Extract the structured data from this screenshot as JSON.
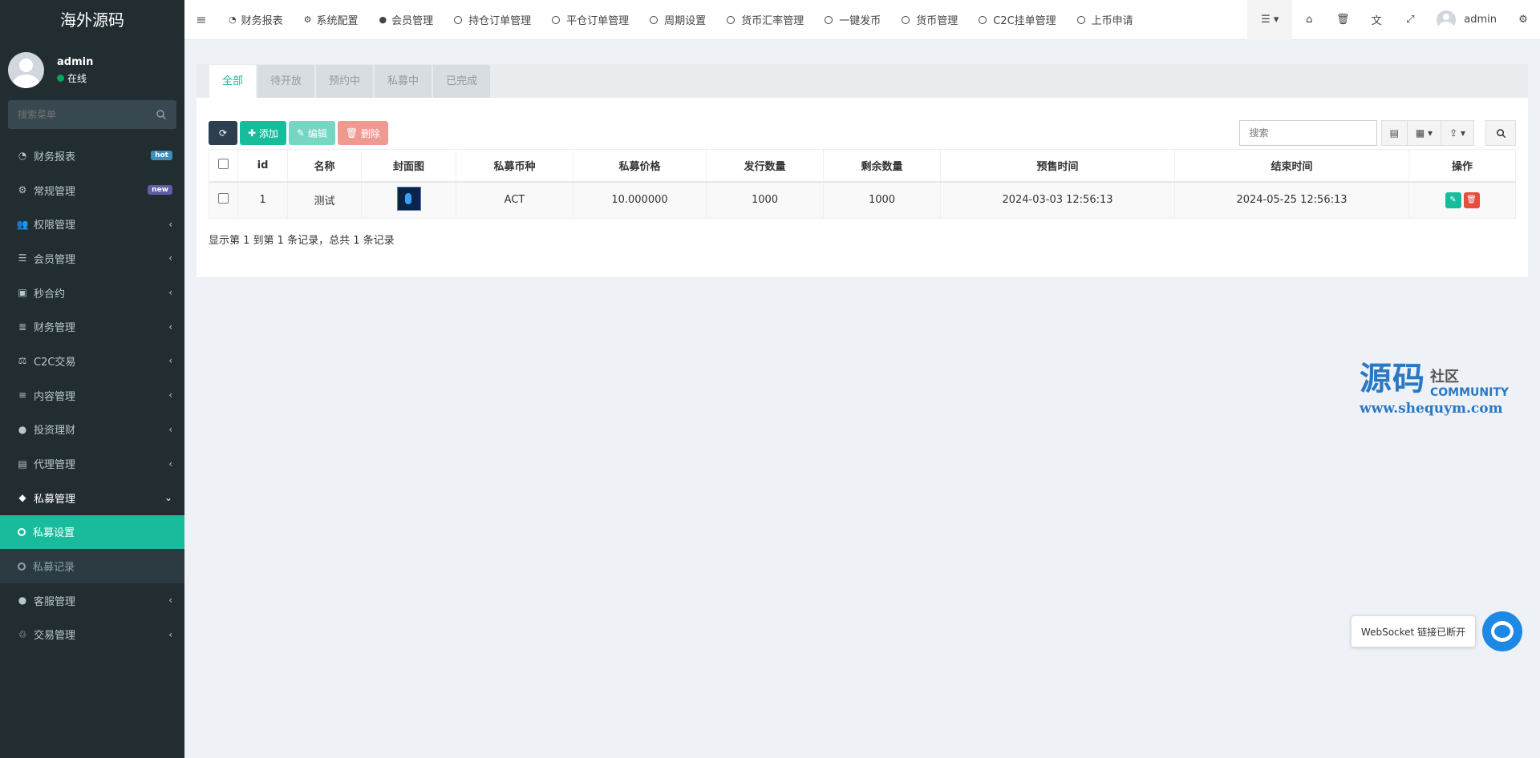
{
  "brand": "海外源码",
  "user": {
    "name": "admin",
    "status": "在线"
  },
  "sidebar_search": {
    "placeholder": "搜索菜单"
  },
  "menu": [
    {
      "label": "财务报表",
      "icon": "dashboard-icon",
      "badge": "hot"
    },
    {
      "label": "常规管理",
      "icon": "cogs-icon",
      "badge": "new"
    },
    {
      "label": "权限管理",
      "icon": "group-icon"
    },
    {
      "label": "会员管理",
      "icon": "list-icon"
    },
    {
      "label": "秒合约",
      "icon": "calendar-icon"
    },
    {
      "label": "财务管理",
      "icon": "database-icon"
    },
    {
      "label": "C2C交易",
      "icon": "balance-scale-icon"
    },
    {
      "label": "内容管理",
      "icon": "align-left-icon"
    },
    {
      "label": "投资理财",
      "icon": "compass-icon"
    },
    {
      "label": "代理管理",
      "icon": "briefcase-icon"
    },
    {
      "label": "私募管理",
      "icon": "diamond-icon",
      "open": true,
      "children": [
        {
          "label": "私募设置",
          "active": true
        },
        {
          "label": "私募记录"
        }
      ]
    },
    {
      "label": "客服管理",
      "icon": "comment-icon"
    },
    {
      "label": "交易管理",
      "icon": "handshake-icon"
    }
  ],
  "topnav": [
    {
      "label": "财务报表",
      "icon": "dashboard-icon"
    },
    {
      "label": "系统配置",
      "icon": "gear-icon"
    },
    {
      "label": "会员管理",
      "icon": "user-icon"
    },
    {
      "label": "持仓订单管理",
      "icon": "circle-icon"
    },
    {
      "label": "平仓订单管理",
      "icon": "circle-icon"
    },
    {
      "label": "周期设置",
      "icon": "circle-icon"
    },
    {
      "label": "货币汇率管理",
      "icon": "circle-icon"
    },
    {
      "label": "一键发币",
      "icon": "circle-icon"
    },
    {
      "label": "货币管理",
      "icon": "circle-icon"
    },
    {
      "label": "C2C挂单管理",
      "icon": "circle-icon"
    },
    {
      "label": "上币申请",
      "icon": "circle-icon"
    }
  ],
  "top_user": "admin",
  "tabs": [
    "全部",
    "待开放",
    "预约中",
    "私募中",
    "已完成"
  ],
  "toolbar": {
    "add": "添加",
    "edit": "编辑",
    "delete": "删除",
    "search_placeholder": "搜索"
  },
  "table": {
    "headers": [
      "id",
      "名称",
      "封面图",
      "私募币种",
      "私募价格",
      "发行数量",
      "剩余数量",
      "预售时间",
      "结束时间",
      "操作"
    ],
    "rows": [
      {
        "id": "1",
        "name": "测试",
        "coin": "ACT",
        "price": "10.000000",
        "issue": "1000",
        "remain": "1000",
        "presale": "2024-03-03 12:56:13",
        "end": "2024-05-25 12:56:13"
      }
    ]
  },
  "pager": "显示第 1 到第 1 条记录，总共 1 条记录",
  "watermark": {
    "big": "源码",
    "cn": "社区",
    "en": "COMMUNITY",
    "url": "www.shequym.com"
  },
  "websocket": "WebSocket 链接已断开",
  "colors": {
    "accent": "#18bc9c",
    "sidebar": "#222d32",
    "danger": "#e74c3c",
    "dark_btn": "#2c3e50"
  }
}
